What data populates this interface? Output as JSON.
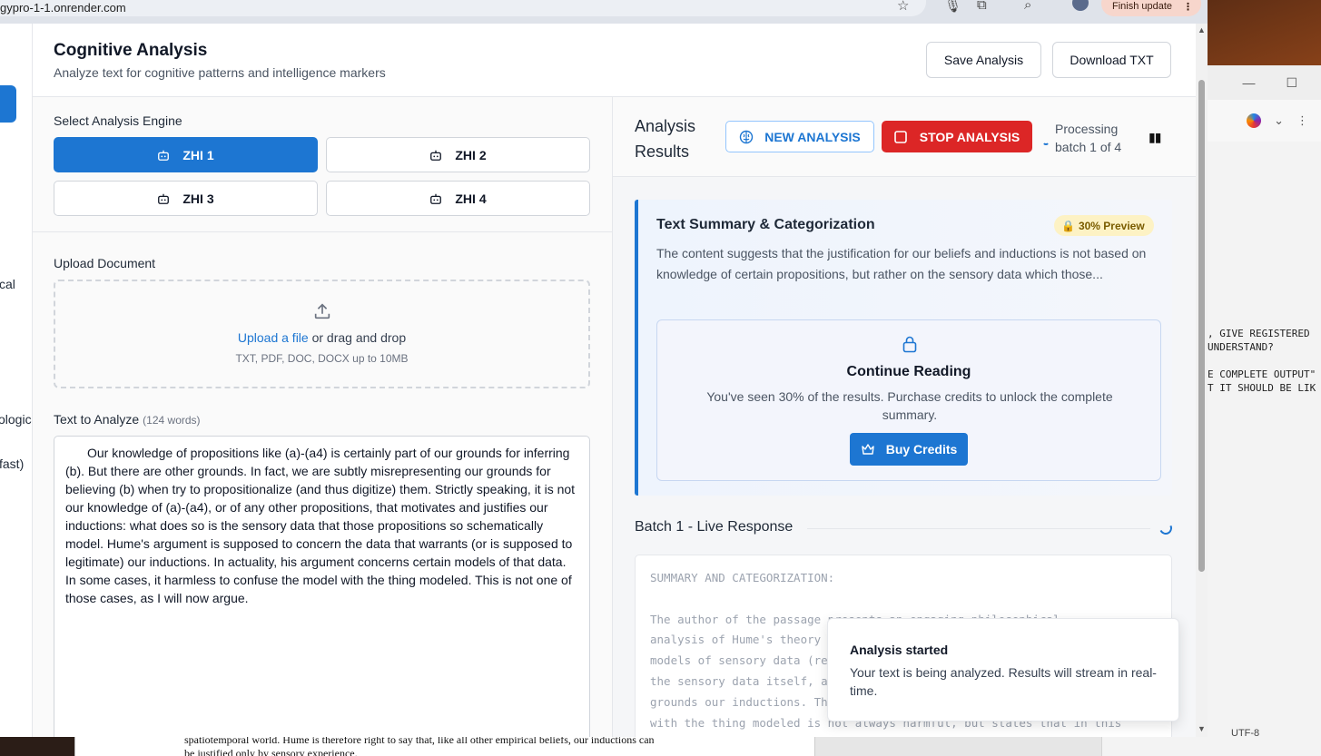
{
  "browser": {
    "url": "gypro-1-1.onrender.com",
    "finish_update": "Finish update"
  },
  "sidebar": {
    "labels": [
      "cal",
      "ological",
      "fast)"
    ]
  },
  "header": {
    "title": "Cognitive Analysis",
    "subtitle": "Analyze text for cognitive patterns and intelligence markers",
    "save_label": "Save Analysis",
    "download_label": "Download TXT"
  },
  "engine": {
    "label": "Select Analysis Engine",
    "options": [
      "ZHI 1",
      "ZHI 2",
      "ZHI 3",
      "ZHI 4"
    ],
    "selected": "ZHI 1"
  },
  "upload": {
    "label": "Upload Document",
    "link": "Upload a file",
    "drag": " or drag and drop",
    "hint": "TXT, PDF, DOC, DOCX up to 10MB"
  },
  "text_input": {
    "label": "Text to Analyze",
    "word_count": "(124 words)",
    "value": "Our knowledge of propositions like (a)-(a4) is certainly part of our grounds for inferring (b). But there are other grounds. In fact, we are subtly misrepresenting our grounds for believing (b) when try to propositionalize (and thus digitize) them. Strictly speaking, it is not our knowledge of (a)-(a4), or of any other propositions, that motivates and justifies our inductions: what does so is the sensory data that those propositions so schematically model. Hume's argument is supposed to concern the data that warrants (or is supposed to legitimate) our inductions. In actuality, his argument concerns certain models of that data. In some cases, it harmless to confuse the model with the thing modeled. This is not one of those cases, as I will now argue."
  },
  "results": {
    "title": "Analysis Results",
    "new_label": "NEW ANALYSIS",
    "stop_label": "STOP ANALYSIS",
    "status": "Processing batch 1 of 4",
    "summary": {
      "title": "Text Summary & Categorization",
      "badge": "30% Preview",
      "text": "The content suggests that the justification for our beliefs and inductions is not based on knowledge of certain propositions, but rather on the sensory data which those...",
      "lock_title": "Continue Reading",
      "lock_text": "You've seen 30% of the results. Purchase credits to unlock the complete summary.",
      "buy_label": "Buy Credits"
    },
    "batch_title": "Batch 1 - Live Response",
    "live_text": "SUMMARY AND CATEGORIZATION:\n\nThe author of the passage presents an engaging philosophical\nanalysis of Hume's theory of induction, arguing that Hume addresses\nmodels of sensory data (represented as propositions) rather than\nthe sensory data itself, and that it is this sensory data which\ngrounds our inductions. The author contends that confusing the model\nwith the thing modeled is not always harmful, but states that in this"
  },
  "toast": {
    "title": "Analysis started",
    "text": "Your text is being analyzed. Results will stream in real-time."
  },
  "background": {
    "notepad_text": ", GIVE REGISTERED\nUNDERSTAND?\n\nE COMPLETE OUTPUT\"\nT IT SHOULD BE LIK",
    "encoding": "UTF-8",
    "doc_text": "spatiotemporal world. Hume is therefore right to say that, like all other empirical beliefs, our inductions can\nbe justified only by sensory experience."
  },
  "colors": {
    "accent": "#1d76d2",
    "danger": "#dc2626",
    "badge_bg": "#fdf2c4"
  }
}
